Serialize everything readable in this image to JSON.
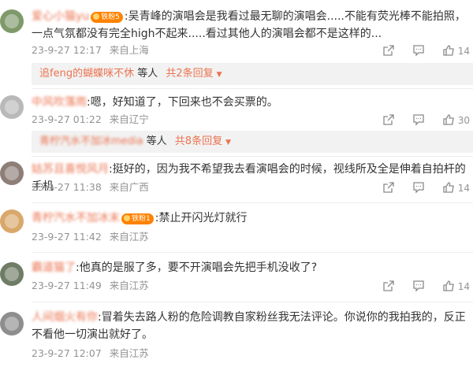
{
  "comments": [
    {
      "username": "爱心小猫yu",
      "badge": "铁粉5",
      "colon": ":",
      "text": "吴青峰的演唱会是我看过最无聊的演唱会.....不能有荧光棒不能拍照，一点气氛都没有完全high不起来.....看过其他人的演唱会都不是这样的...",
      "date": "23-9-27 12:17",
      "location": "来自上海",
      "likes": "14",
      "avatar_color": "#7f9a6a"
    },
    {
      "username": "中风吹落雨",
      "badge": "",
      "colon": ":",
      "text": "嗯，好知道了，下回来也不会买票的。",
      "date": "23-9-27 01:22",
      "location": "来自辽宁",
      "likes": "30",
      "avatar_color": "#b9b9b9"
    },
    {
      "username": "姑苏且喜悦风月",
      "badge": "",
      "colon": ":",
      "text": "挺好的，因为我不希望我去看演唱会的时候，视线所及全是伸着自拍杆的手机",
      "date": "23-9-27 11:38",
      "location": "来自广西",
      "likes": "14",
      "avatar_color": "#8d7f78"
    },
    {
      "username": "青柠汽水不加冰末",
      "badge": "铁粉1",
      "colon": ":",
      "text": "禁止开闪光灯就行",
      "date": "23-9-27 11:42",
      "location": "来自江苏",
      "likes": "",
      "avatar_color": "#d9a86a"
    },
    {
      "username": "霸道猫了",
      "badge": "",
      "colon": ":",
      "text": "他真的是服了多，要不开演唱会先把手机没收了?",
      "date": "23-9-27 11:49",
      "location": "来自江苏",
      "likes": "14",
      "avatar_color": "#6f7c66"
    },
    {
      "username": "人间烟火有你",
      "badge": "",
      "colon": ":",
      "text": "冒着失去路人粉的危险调教自家粉丝我无法评论。你说你的我拍我的，反正不看他一切演出就好了。",
      "date": "23-9-27 12:07",
      "location": "来自江苏",
      "likes": "",
      "avatar_color": "#8e8e8e"
    }
  ],
  "replies": [
    {
      "names": "追feng的蝴蝶咪不休",
      "suffix": "等人",
      "count": "共2条回复"
    },
    {
      "names": "青柠汽水不加冰media",
      "suffix": "等人",
      "count": "共8条回复"
    }
  ]
}
